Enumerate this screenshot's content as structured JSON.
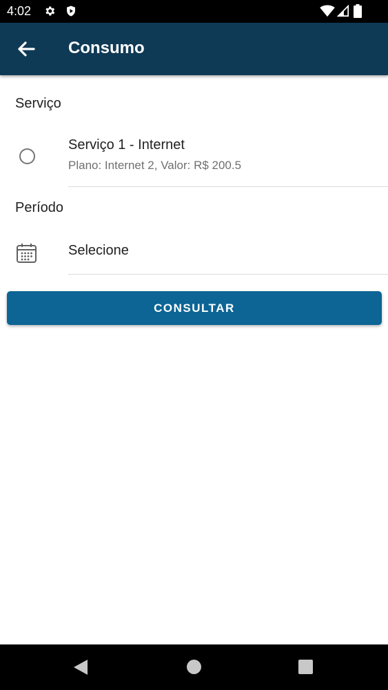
{
  "status_bar": {
    "time": "4:02",
    "icons": [
      "gear-icon",
      "shield-icon",
      "wifi-icon",
      "signal-icon",
      "battery-icon"
    ]
  },
  "app_bar": {
    "title": "Consumo",
    "back_icon": "arrow-left-icon",
    "background": "#0f3a56"
  },
  "service": {
    "section_label": "Serviço",
    "items": [
      {
        "title": "Serviço 1 - Internet",
        "subtitle": "Plano: Internet 2, Valor: R$ 200.5",
        "selected": false
      }
    ]
  },
  "period": {
    "section_label": "Período",
    "value": "Selecione",
    "icon": "calendar-icon"
  },
  "actions": {
    "consultar_label": "CONSULTAR",
    "color": "#0c6595"
  },
  "nav_bar": {
    "icons": [
      "back-triangle-icon",
      "home-circle-icon",
      "recents-square-icon"
    ]
  }
}
